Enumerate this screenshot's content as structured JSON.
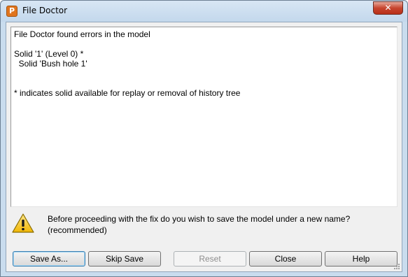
{
  "window": {
    "title": "File Doctor",
    "app_icon_letter": "P",
    "close_glyph": "✕"
  },
  "report": {
    "lines": [
      "File Doctor found errors in the model",
      "",
      "Solid '1' (Level 0) *",
      "  Solid 'Bush hole 1'",
      "",
      "",
      "* indicates solid available for replay or removal of history tree"
    ]
  },
  "prompt": {
    "line1": "Before proceeding with the fix do you wish to save the model under a new name?",
    "line2": "(recommended)"
  },
  "buttons": {
    "save_as": "Save As...",
    "skip_save": "Skip Save",
    "reset": "Reset",
    "close": "Close",
    "help": "Help"
  },
  "colors": {
    "accent": "#3c7fb1",
    "warning": "#f5c518",
    "titlebar": "#c9dcee"
  },
  "icons": {
    "warning": "warning-icon",
    "app": "app-icon",
    "close": "close-icon"
  }
}
